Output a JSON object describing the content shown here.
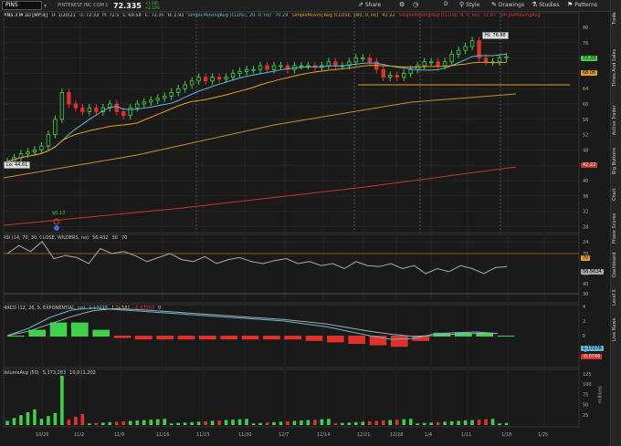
{
  "toolbar": {
    "symbol": "PINS",
    "company": "PINTEREST INC COM CL A",
    "price": "72.335",
    "change_abs": "+1.505",
    "change_pct": "+2.12%",
    "share": "Share",
    "period": "D",
    "style": "Style",
    "drawings": "Drawings",
    "studies": "Studies",
    "patterns": "Patterns"
  },
  "legend": {
    "main": "PINS 3 M 1D [NYSE]",
    "date": "D: 1/20/21",
    "open": "O: 72.33",
    "high": "H: 72.5",
    "low": "L: 69.58",
    "close": "C: 72.36",
    "range": "R: 2.92",
    "sma20": "SimpleMovingAvg (CLOSE, 20, 0, no)",
    "sma20_val": "70.29",
    "sma180": "SimpleMovingAvg (CLOSE, 180, 0, no)",
    "sma180_val": "42.22",
    "sma9": "SimpleMovingAvg (CLOSE, 9, 0, no)",
    "sma9_val": "71.87",
    "sma": "SimpleMovingAvg"
  },
  "rsi": {
    "legend": "RSI (14, 70, 30, CLOSE, WILDERS, no)",
    "value": "56.432",
    "ob": "30",
    "os": "70",
    "tag": "56.5624",
    "level_label": "70"
  },
  "macd": {
    "legend": "MACD (12, 26, 9, EXPONENTIAL, no)",
    "value": "1.17278",
    "avg": "1.24581",
    "diff": "-0.07303",
    "zero": "0",
    "tag1": "1.17278",
    "tag2": "-0.0746"
  },
  "volume": {
    "legend": "VolumeAvg (50)",
    "value": "5,373,283",
    "avg": "10,051,202",
    "tag": "125",
    "unit": "millions"
  },
  "price_tags": {
    "last": "72.33",
    "sma20": "68.06",
    "sma180": "42.22",
    "hi": "Hi: 76.88",
    "lo": "Lo: 44.61",
    "div": "$0.13"
  },
  "y_ticks": [
    "80",
    "76",
    "72",
    "68",
    "64",
    "60",
    "56",
    "52",
    "48",
    "44",
    "40",
    "36",
    "32",
    "28",
    "24"
  ],
  "rsi_ticks": [
    "70",
    "50",
    "40",
    "30"
  ],
  "macd_ticks": [
    "4",
    "2",
    "0",
    "-2"
  ],
  "vol_ticks": [
    "125",
    "100",
    "75",
    "50",
    "25"
  ],
  "x_ticks": [
    "10/26",
    "11/2",
    "11/9",
    "11/16",
    "11/23",
    "11/30",
    "12/7",
    "12/14",
    "12/21",
    "12/28",
    "1/4",
    "1/11",
    "1/18",
    "1/25"
  ],
  "right_tabs": [
    "Trade",
    "Times And Sales",
    "Active Trader",
    "Big Buttons",
    "Chart",
    "Phase Scores",
    "Dashboard",
    "Level II",
    "Live News"
  ],
  "colors": {
    "up": "#3fd14a",
    "down": "#e0312a",
    "sma20": "#e6a020",
    "sma9": "#5fb8d8",
    "sma180": "#c0392b"
  }
}
